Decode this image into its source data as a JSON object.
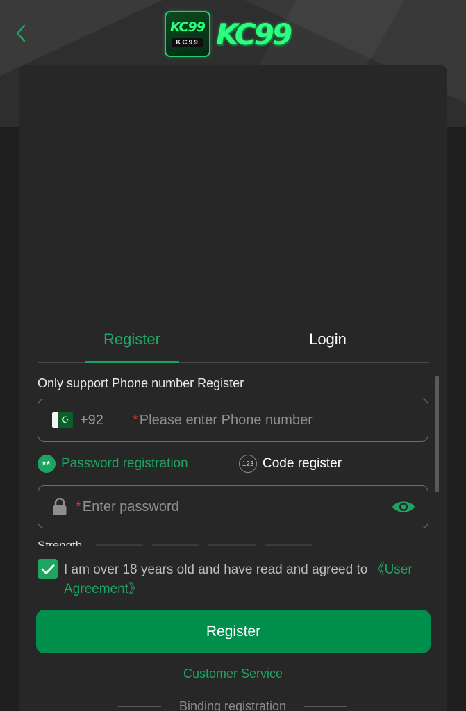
{
  "header": {
    "logo_badge_big": "KC99",
    "logo_badge_small": "KC99",
    "logo_text": "KC99"
  },
  "tabs": [
    {
      "label": "Register",
      "active": true
    },
    {
      "label": "Login",
      "active": false
    }
  ],
  "form": {
    "support_note": "Only support Phone number Register",
    "phone": {
      "country_flag": "pakistan-flag-icon",
      "dial_code": "+92",
      "required_mark": "*",
      "placeholder": "Please enter Phone number",
      "value": ""
    },
    "methods": [
      {
        "icon_text": "**",
        "label": "Password registration",
        "selected": true
      },
      {
        "icon_text": "123",
        "label": "Code register",
        "selected": false
      }
    ],
    "password": {
      "required_mark": "*",
      "placeholder": "Enter password",
      "value": ""
    },
    "strength_label": "Strength",
    "agreement": {
      "checked": true,
      "text": "I am over 18 years old and have read and agreed to ",
      "link": "《User Agreement》"
    },
    "submit_label": "Register"
  },
  "footer": {
    "customer_service": "Customer Service",
    "binding_registration": "Binding registration"
  },
  "colors": {
    "accent": "#1ea361",
    "button": "#00904b",
    "required": "#e23a3a",
    "background": "#1f1f1f",
    "card": "#272727"
  }
}
